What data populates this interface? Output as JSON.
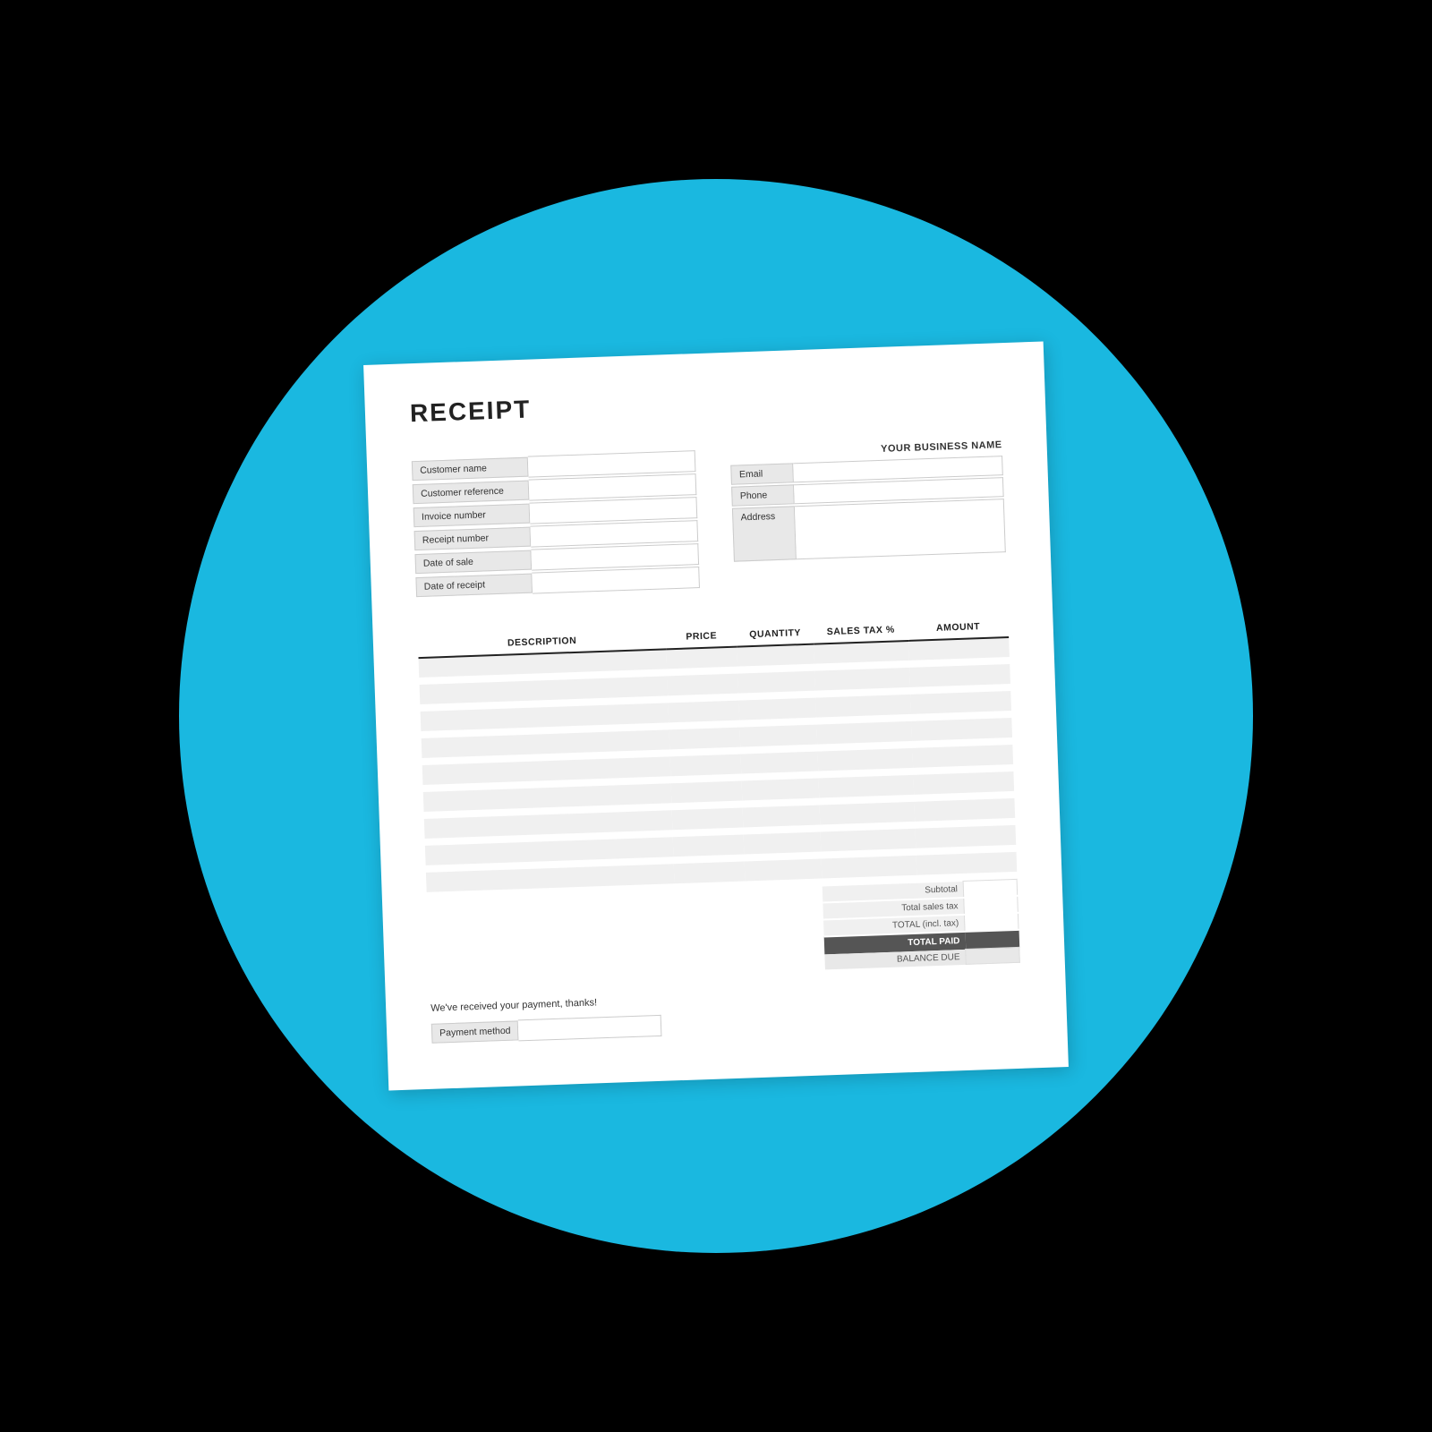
{
  "background": {
    "circle_color": "#1ab8e0"
  },
  "receipt": {
    "title": "RECEIPT",
    "business_name_label": "YOUR BUSINESS NAME",
    "left_fields": [
      {
        "label": "Customer name",
        "value": ""
      },
      {
        "label": "Customer reference",
        "value": ""
      },
      {
        "label": "Invoice number",
        "value": ""
      },
      {
        "label": "Receipt number",
        "value": ""
      },
      {
        "label": "Date of sale",
        "value": ""
      },
      {
        "label": "Date of receipt",
        "value": ""
      }
    ],
    "right_fields": [
      {
        "label": "Email",
        "value": "",
        "multiline": false
      },
      {
        "label": "Phone",
        "value": "",
        "multiline": false
      },
      {
        "label": "Address",
        "value": "",
        "multiline": true
      }
    ],
    "table": {
      "columns": [
        {
          "key": "description",
          "label": "DESCRIPTION"
        },
        {
          "key": "price",
          "label": "PRICE"
        },
        {
          "key": "quantity",
          "label": "QUANTITY"
        },
        {
          "key": "sales_tax",
          "label": "SALES TAX %"
        },
        {
          "key": "amount",
          "label": "AMOUNT"
        }
      ],
      "rows": 9
    },
    "totals": [
      {
        "label": "Subtotal",
        "value": ""
      },
      {
        "label": "Total sales tax",
        "value": ""
      },
      {
        "label": "TOTAL (incl. tax)",
        "value": ""
      },
      {
        "label": "TOTAL PAID",
        "value": "",
        "highlight": true
      },
      {
        "label": "BALANCE DUE",
        "value": ""
      }
    ],
    "thank_you_message": "We've received your payment, thanks!",
    "payment_method_label": "Payment method",
    "payment_method_value": ""
  }
}
